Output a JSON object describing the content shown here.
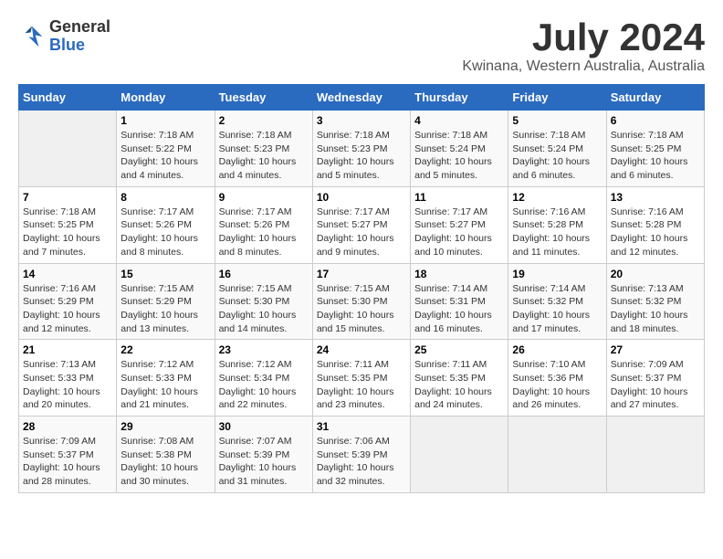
{
  "header": {
    "logo_line1": "General",
    "logo_line2": "Blue",
    "month": "July 2024",
    "location": "Kwinana, Western Australia, Australia"
  },
  "weekdays": [
    "Sunday",
    "Monday",
    "Tuesday",
    "Wednesday",
    "Thursday",
    "Friday",
    "Saturday"
  ],
  "weeks": [
    [
      {
        "day": "",
        "info": ""
      },
      {
        "day": "1",
        "info": "Sunrise: 7:18 AM\nSunset: 5:22 PM\nDaylight: 10 hours\nand 4 minutes."
      },
      {
        "day": "2",
        "info": "Sunrise: 7:18 AM\nSunset: 5:23 PM\nDaylight: 10 hours\nand 4 minutes."
      },
      {
        "day": "3",
        "info": "Sunrise: 7:18 AM\nSunset: 5:23 PM\nDaylight: 10 hours\nand 5 minutes."
      },
      {
        "day": "4",
        "info": "Sunrise: 7:18 AM\nSunset: 5:24 PM\nDaylight: 10 hours\nand 5 minutes."
      },
      {
        "day": "5",
        "info": "Sunrise: 7:18 AM\nSunset: 5:24 PM\nDaylight: 10 hours\nand 6 minutes."
      },
      {
        "day": "6",
        "info": "Sunrise: 7:18 AM\nSunset: 5:25 PM\nDaylight: 10 hours\nand 6 minutes."
      }
    ],
    [
      {
        "day": "7",
        "info": "Sunrise: 7:18 AM\nSunset: 5:25 PM\nDaylight: 10 hours\nand 7 minutes."
      },
      {
        "day": "8",
        "info": "Sunrise: 7:17 AM\nSunset: 5:26 PM\nDaylight: 10 hours\nand 8 minutes."
      },
      {
        "day": "9",
        "info": "Sunrise: 7:17 AM\nSunset: 5:26 PM\nDaylight: 10 hours\nand 8 minutes."
      },
      {
        "day": "10",
        "info": "Sunrise: 7:17 AM\nSunset: 5:27 PM\nDaylight: 10 hours\nand 9 minutes."
      },
      {
        "day": "11",
        "info": "Sunrise: 7:17 AM\nSunset: 5:27 PM\nDaylight: 10 hours\nand 10 minutes."
      },
      {
        "day": "12",
        "info": "Sunrise: 7:16 AM\nSunset: 5:28 PM\nDaylight: 10 hours\nand 11 minutes."
      },
      {
        "day": "13",
        "info": "Sunrise: 7:16 AM\nSunset: 5:28 PM\nDaylight: 10 hours\nand 12 minutes."
      }
    ],
    [
      {
        "day": "14",
        "info": "Sunrise: 7:16 AM\nSunset: 5:29 PM\nDaylight: 10 hours\nand 12 minutes."
      },
      {
        "day": "15",
        "info": "Sunrise: 7:15 AM\nSunset: 5:29 PM\nDaylight: 10 hours\nand 13 minutes."
      },
      {
        "day": "16",
        "info": "Sunrise: 7:15 AM\nSunset: 5:30 PM\nDaylight: 10 hours\nand 14 minutes."
      },
      {
        "day": "17",
        "info": "Sunrise: 7:15 AM\nSunset: 5:30 PM\nDaylight: 10 hours\nand 15 minutes."
      },
      {
        "day": "18",
        "info": "Sunrise: 7:14 AM\nSunset: 5:31 PM\nDaylight: 10 hours\nand 16 minutes."
      },
      {
        "day": "19",
        "info": "Sunrise: 7:14 AM\nSunset: 5:32 PM\nDaylight: 10 hours\nand 17 minutes."
      },
      {
        "day": "20",
        "info": "Sunrise: 7:13 AM\nSunset: 5:32 PM\nDaylight: 10 hours\nand 18 minutes."
      }
    ],
    [
      {
        "day": "21",
        "info": "Sunrise: 7:13 AM\nSunset: 5:33 PM\nDaylight: 10 hours\nand 20 minutes."
      },
      {
        "day": "22",
        "info": "Sunrise: 7:12 AM\nSunset: 5:33 PM\nDaylight: 10 hours\nand 21 minutes."
      },
      {
        "day": "23",
        "info": "Sunrise: 7:12 AM\nSunset: 5:34 PM\nDaylight: 10 hours\nand 22 minutes."
      },
      {
        "day": "24",
        "info": "Sunrise: 7:11 AM\nSunset: 5:35 PM\nDaylight: 10 hours\nand 23 minutes."
      },
      {
        "day": "25",
        "info": "Sunrise: 7:11 AM\nSunset: 5:35 PM\nDaylight: 10 hours\nand 24 minutes."
      },
      {
        "day": "26",
        "info": "Sunrise: 7:10 AM\nSunset: 5:36 PM\nDaylight: 10 hours\nand 26 minutes."
      },
      {
        "day": "27",
        "info": "Sunrise: 7:09 AM\nSunset: 5:37 PM\nDaylight: 10 hours\nand 27 minutes."
      }
    ],
    [
      {
        "day": "28",
        "info": "Sunrise: 7:09 AM\nSunset: 5:37 PM\nDaylight: 10 hours\nand 28 minutes."
      },
      {
        "day": "29",
        "info": "Sunrise: 7:08 AM\nSunset: 5:38 PM\nDaylight: 10 hours\nand 30 minutes."
      },
      {
        "day": "30",
        "info": "Sunrise: 7:07 AM\nSunset: 5:39 PM\nDaylight: 10 hours\nand 31 minutes."
      },
      {
        "day": "31",
        "info": "Sunrise: 7:06 AM\nSunset: 5:39 PM\nDaylight: 10 hours\nand 32 minutes."
      },
      {
        "day": "",
        "info": ""
      },
      {
        "day": "",
        "info": ""
      },
      {
        "day": "",
        "info": ""
      }
    ]
  ]
}
